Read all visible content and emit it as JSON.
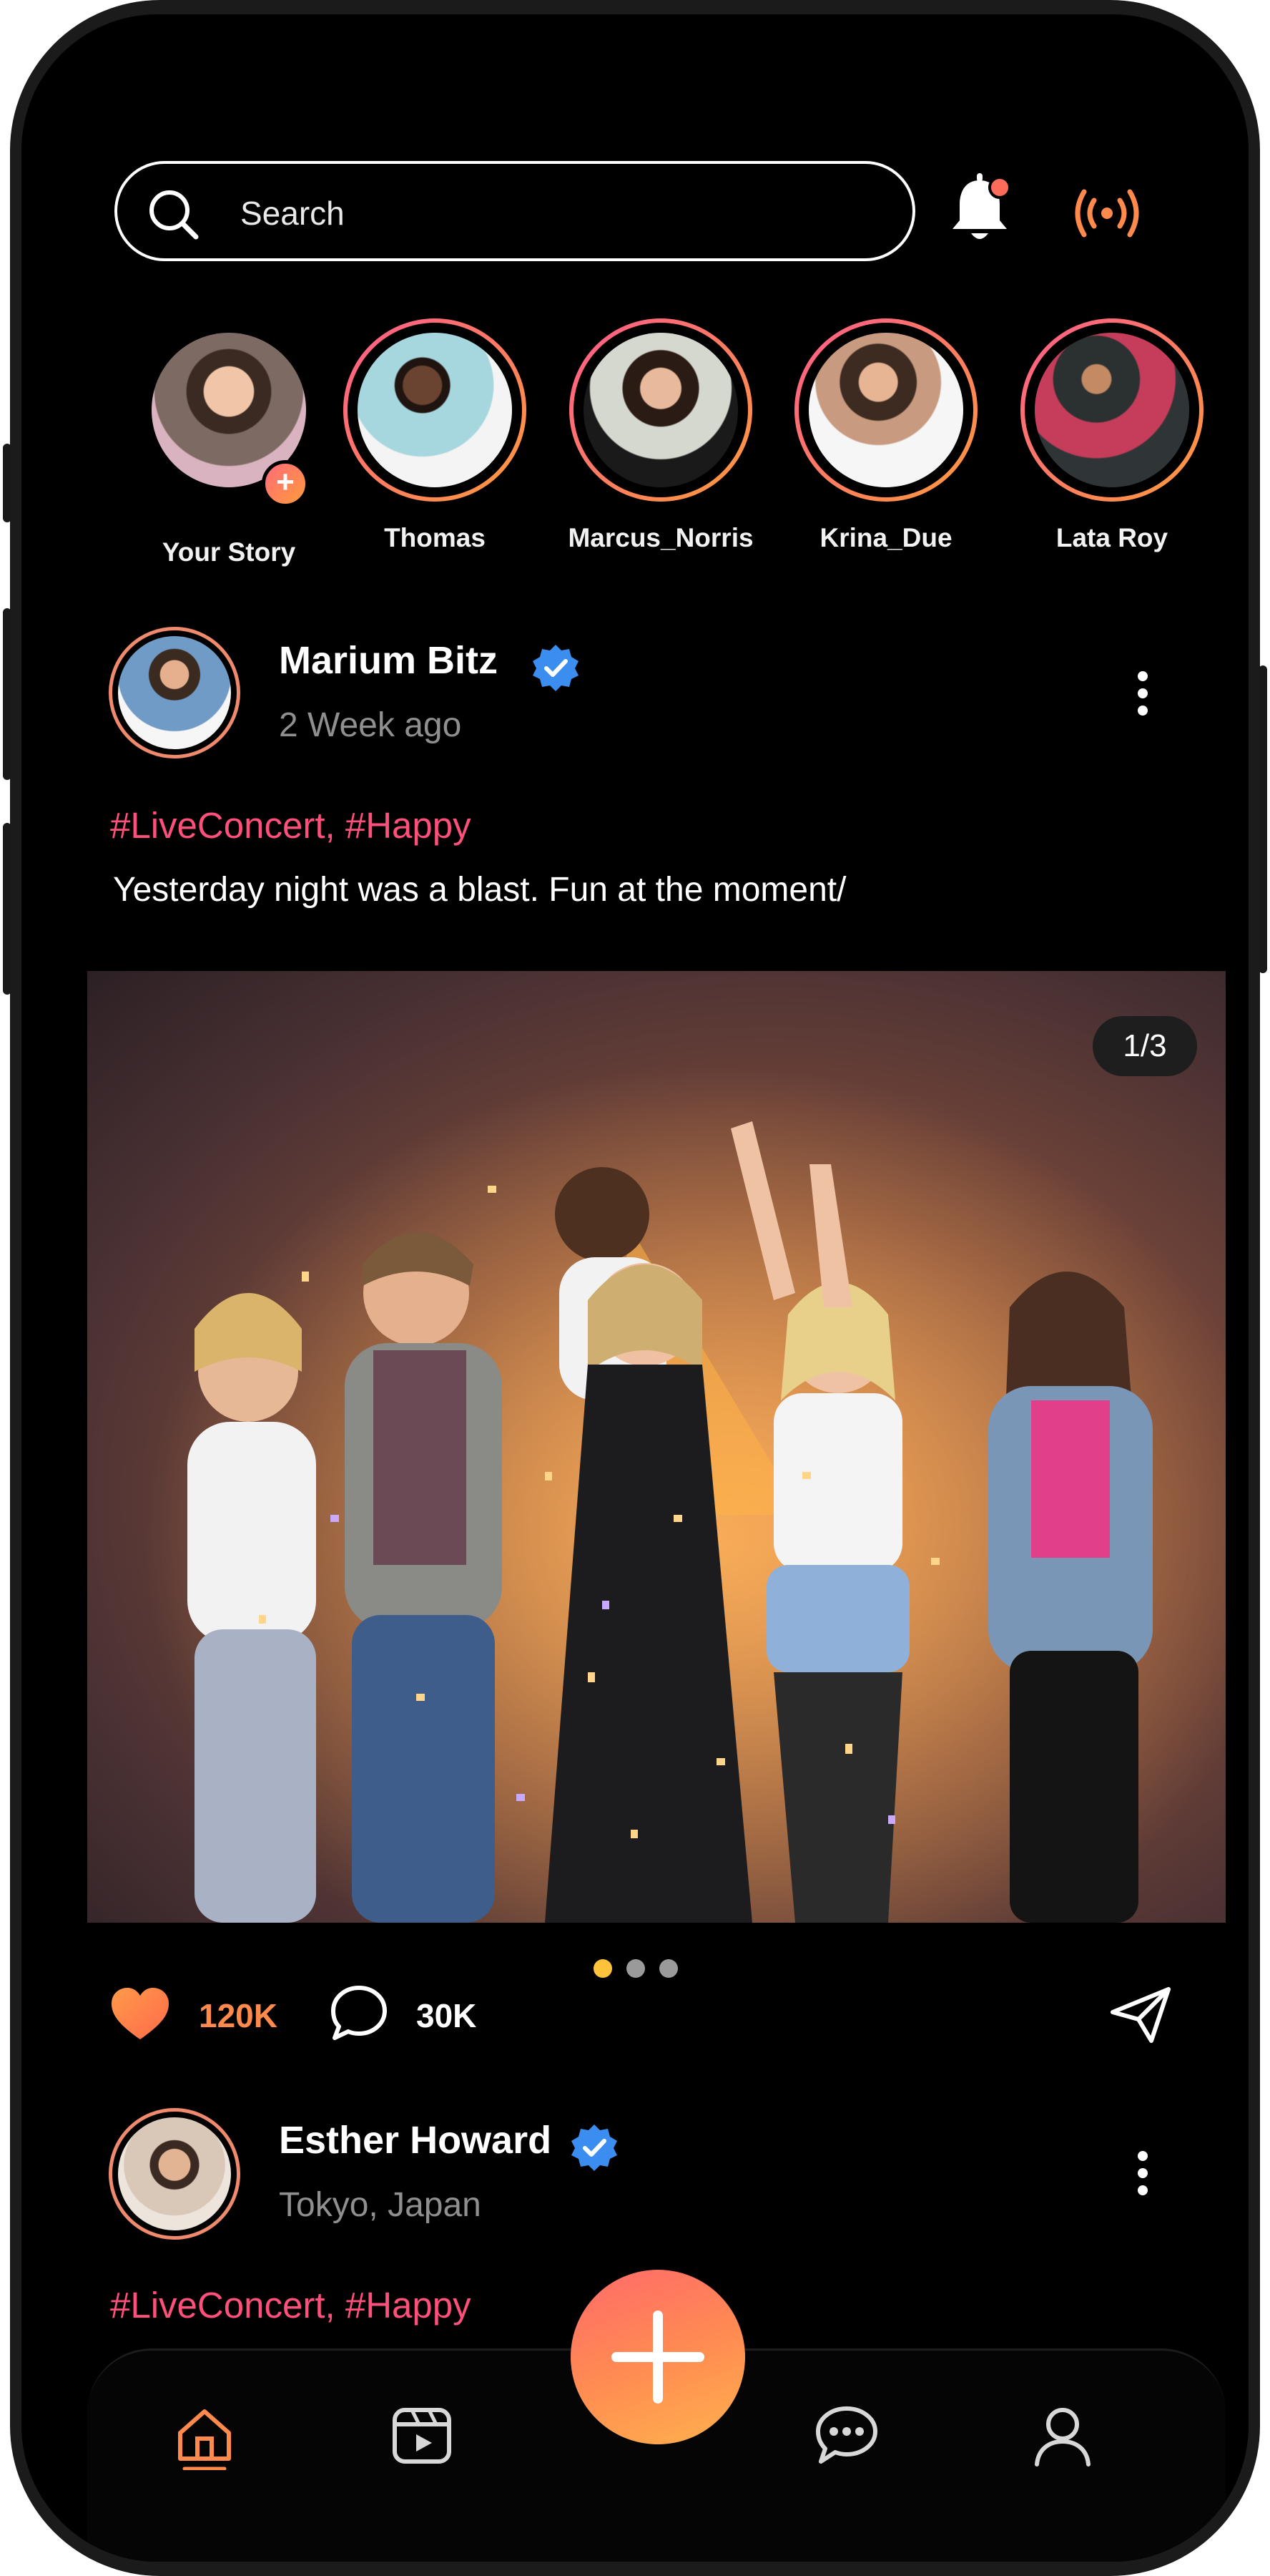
{
  "search": {
    "placeholder": "Search",
    "icon": "search-icon"
  },
  "header": {
    "notification_icon": "bell-icon",
    "live_icon": "broadcast-icon"
  },
  "stories": [
    {
      "name": "Your Story",
      "add_icon": "plus-icon"
    },
    {
      "name": "Thomas"
    },
    {
      "name": "Marcus_Norris"
    },
    {
      "name": "Krina_Due"
    },
    {
      "name": "Lata Roy"
    }
  ],
  "posts": [
    {
      "author": "Marium Bitz",
      "verified": true,
      "subtitle": "2 Week ago",
      "tags": "#LiveConcert, #Happy",
      "caption": "Yesterday night was a blast. Fun at the moment/",
      "image_counter": "1/3",
      "carousel": {
        "count": 3,
        "active": 1
      },
      "likes": "120K",
      "comments": "30K"
    },
    {
      "author": "Esther Howard",
      "verified": true,
      "subtitle": "Tokyo, Japan",
      "tags": "#LiveConcert, #Happy"
    }
  ],
  "nav": {
    "items": [
      "home-icon",
      "reels-icon",
      "add-post-button",
      "chat-icon",
      "profile-icon"
    ],
    "active": "home-icon"
  },
  "colors": {
    "background": "#000000",
    "accent_orange": "#ff8a4c",
    "accent_pink": "#ff4f7b",
    "verified_blue": "#3b8ef0",
    "active_dot": "#ffc23a",
    "muted_text": "#8f8f8f"
  }
}
